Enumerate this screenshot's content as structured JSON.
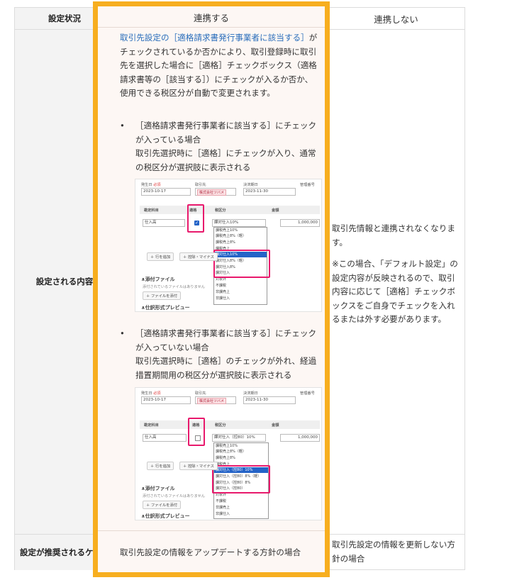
{
  "table": {
    "col_headers": {
      "status": "設定状況",
      "link": "連携する",
      "nolink": "連携しない"
    },
    "row_headers": {
      "content": "設定される内容",
      "recommended": "設定が推奨されるケース"
    },
    "link_content": {
      "intro_link": "取引先設定の［適格請求書発行事業者に該当する］",
      "intro_rest": "がチェックされているか否かにより、取引登録時に取引先を選択した場合に［適格］チェックボックス（適格請求書等の［該当する］）にチェックが入るか否か、使用できる税区分が自動で変更されます。",
      "bullet1_title": "［適格請求書発行事業者に該当する］にチェックが入っている場合",
      "bullet1_body": "取引先選択時に［適格］にチェックが入り、通常の税区分が選択肢に表示される",
      "bullet2_title": "［適格請求書発行事業者に該当する］にチェックが入っていない場合",
      "bullet2_body": "取引先選択時に［適格］のチェックが外れ、経過措置期間用の税区分が選択肢に表示される"
    },
    "nolink_content": {
      "line1": "取引先情報と連携されなくなります。",
      "line2": "※この場合、「デフォルト設定」の設定内容が反映されるので、取引内容に応じて［適格］チェックボックスをご自身でチェックを入れるまたは外す必要があります。"
    },
    "recommended": {
      "link": "取引先設定の情報をアップデートする方針の場合",
      "nolink": "取引先設定の情報を更新しない方針の場合"
    }
  },
  "shot1": {
    "date_label": "発生日",
    "date_required": "必須",
    "date_value": "2023-10-17",
    "partner_label": "取引先",
    "partner_value": "株式会社ツバメ",
    "due_label": "決済期日",
    "due_value": "2023-11-30",
    "mgmt_label": "管理番号",
    "account_label": "勘定科目",
    "qualified_label": "適格",
    "tax_label": "税区分",
    "amount_label": "金額",
    "account_value": "仕入高",
    "tax_value": "課対仕入10%",
    "amount_value": "1,000,000",
    "options": [
      "課税売上10%",
      "課税売上8%（軽）",
      "課税売上8%",
      "課税売上",
      "課対仕入10%",
      "課対仕入8%（軽）",
      "課対仕入8%",
      "課対仕入",
      "対象外",
      "不課税",
      "非課売上",
      "非課仕入"
    ],
    "add_row": "行を追加",
    "deduct": "控除・マイナス",
    "attach_title": "添付ファイル",
    "attach_none": "添付されているファイルはありません",
    "attach_btn": "ファイルを添付",
    "journal_preview": "仕訳形式プレビュー"
  },
  "shot2": {
    "date_label": "発生日",
    "date_value": "2023-10-17",
    "partner_label": "取引先",
    "partner_value": "株式会社ツバメ",
    "due_label": "決済期日",
    "due_value": "2023-11-30",
    "mgmt_label": "管理番号",
    "account_label": "勘定科目",
    "qualified_label": "適格",
    "tax_label": "税区分",
    "amount_label": "金額",
    "account_value": "仕入高",
    "tax_value": "課対仕入（控80）10%",
    "amount_value": "1,000,000",
    "options": [
      "課税売上10%",
      "課税売上8%（軽）",
      "課税売上8%",
      "課税売上",
      "課対仕入（控80）10%",
      "課対仕入（控80）8%（軽）",
      "課対仕入（控80）8%",
      "課対仕入（控80）",
      "対象外",
      "不課税",
      "非課売上",
      "非課仕入"
    ],
    "add_row": "行を追加",
    "deduct": "控除・マイナス",
    "attach_title": "添付ファイル",
    "attach_none": "添付されているファイルはありません",
    "attach_btn": "ファイルを添付",
    "journal_preview": "仕訳形式プレビュー"
  },
  "colors": {
    "highlight_border": "#f7ae1f",
    "highlight_bg": "#fdf7f4",
    "pink_box": "#e8196c",
    "select_blue": "#2463c7",
    "link_blue": "#2a6ebb"
  }
}
